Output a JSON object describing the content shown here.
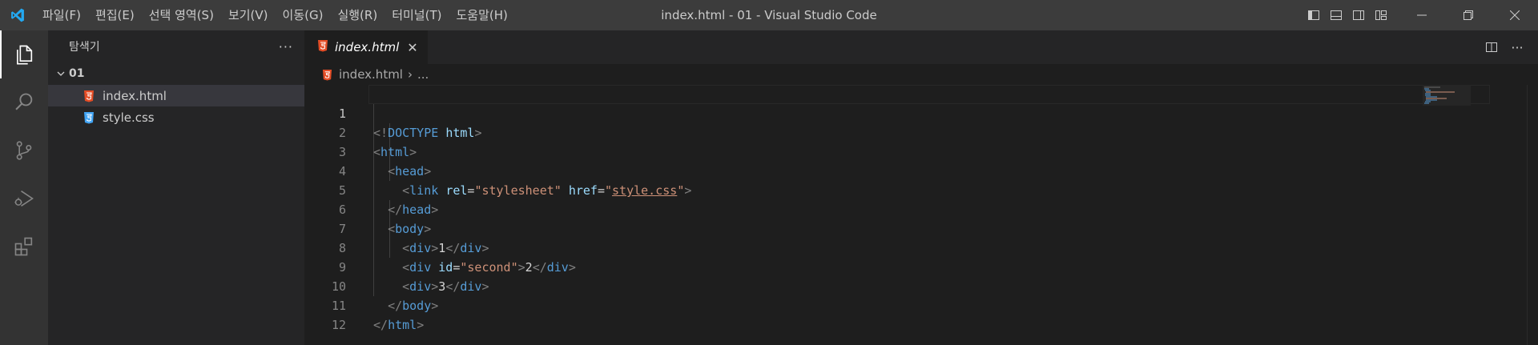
{
  "titlebar": {
    "menu": [
      "파일(F)",
      "편집(E)",
      "선택 영역(S)",
      "보기(V)",
      "이동(G)",
      "실행(R)",
      "터미널(T)",
      "도움말(H)"
    ],
    "window_title": "index.html - 01 - Visual Studio Code"
  },
  "activitybar": {
    "items": [
      "files-icon",
      "search-icon",
      "source-control-icon",
      "run-debug-icon",
      "extensions-icon"
    ]
  },
  "sidebar": {
    "title": "탐색기",
    "folder": "01",
    "files": [
      {
        "name": "index.html",
        "type": "html",
        "selected": true
      },
      {
        "name": "style.css",
        "type": "css",
        "selected": false
      }
    ]
  },
  "editor": {
    "tab_label": "index.html",
    "breadcrumb_file": "index.html",
    "breadcrumb_more": "...",
    "line_numbers": [
      "1",
      "2",
      "3",
      "4",
      "5",
      "6",
      "7",
      "8",
      "9",
      "10",
      "11",
      "12"
    ],
    "active_line": 1
  },
  "colors": {
    "titlebar_bg": "#3c3c3c",
    "activitybar_bg": "#333333",
    "sidebar_bg": "#252526",
    "editor_bg": "#1e1e1e",
    "html_icon": "#e44d26",
    "css_icon": "#42a5f5",
    "vscode_blue": "#23a9f2"
  }
}
